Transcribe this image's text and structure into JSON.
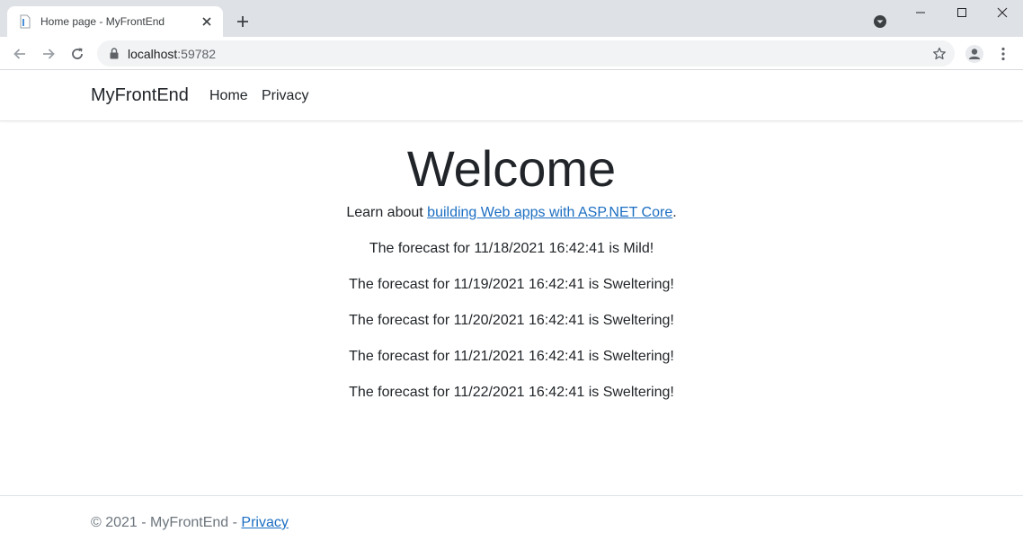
{
  "browser": {
    "tab_title": "Home page - MyFrontEnd",
    "url_host": "localhost",
    "url_port": ":59782"
  },
  "site": {
    "brand": "MyFrontEnd",
    "nav": [
      {
        "label": "Home"
      },
      {
        "label": "Privacy"
      }
    ]
  },
  "main": {
    "heading": "Welcome",
    "lead_prefix": "Learn about ",
    "lead_link": "building Web apps with ASP.NET Core",
    "lead_suffix": ".",
    "forecasts": [
      "The forecast for 11/18/2021 16:42:41 is Mild!",
      "The forecast for 11/19/2021 16:42:41 is Sweltering!",
      "The forecast for 11/20/2021 16:42:41 is Sweltering!",
      "The forecast for 11/21/2021 16:42:41 is Sweltering!",
      "The forecast for 11/22/2021 16:42:41 is Sweltering!"
    ]
  },
  "footer": {
    "text": "© 2021 - MyFrontEnd - ",
    "link": "Privacy"
  },
  "icons": {
    "favicon": "page-icon",
    "tab_close": "close-icon",
    "new_tab": "plus-icon",
    "tab_search": "tab-search-icon",
    "back": "arrow-left-icon",
    "forward": "arrow-right-icon",
    "reload": "reload-icon",
    "lock": "lock-icon",
    "bookmark": "star-icon",
    "profile": "profile-icon",
    "menu": "kebab-menu-icon"
  },
  "colors": {
    "link": "#1b6ec2",
    "tabstrip": "#dee1e6",
    "omnibox": "#f1f3f4"
  }
}
